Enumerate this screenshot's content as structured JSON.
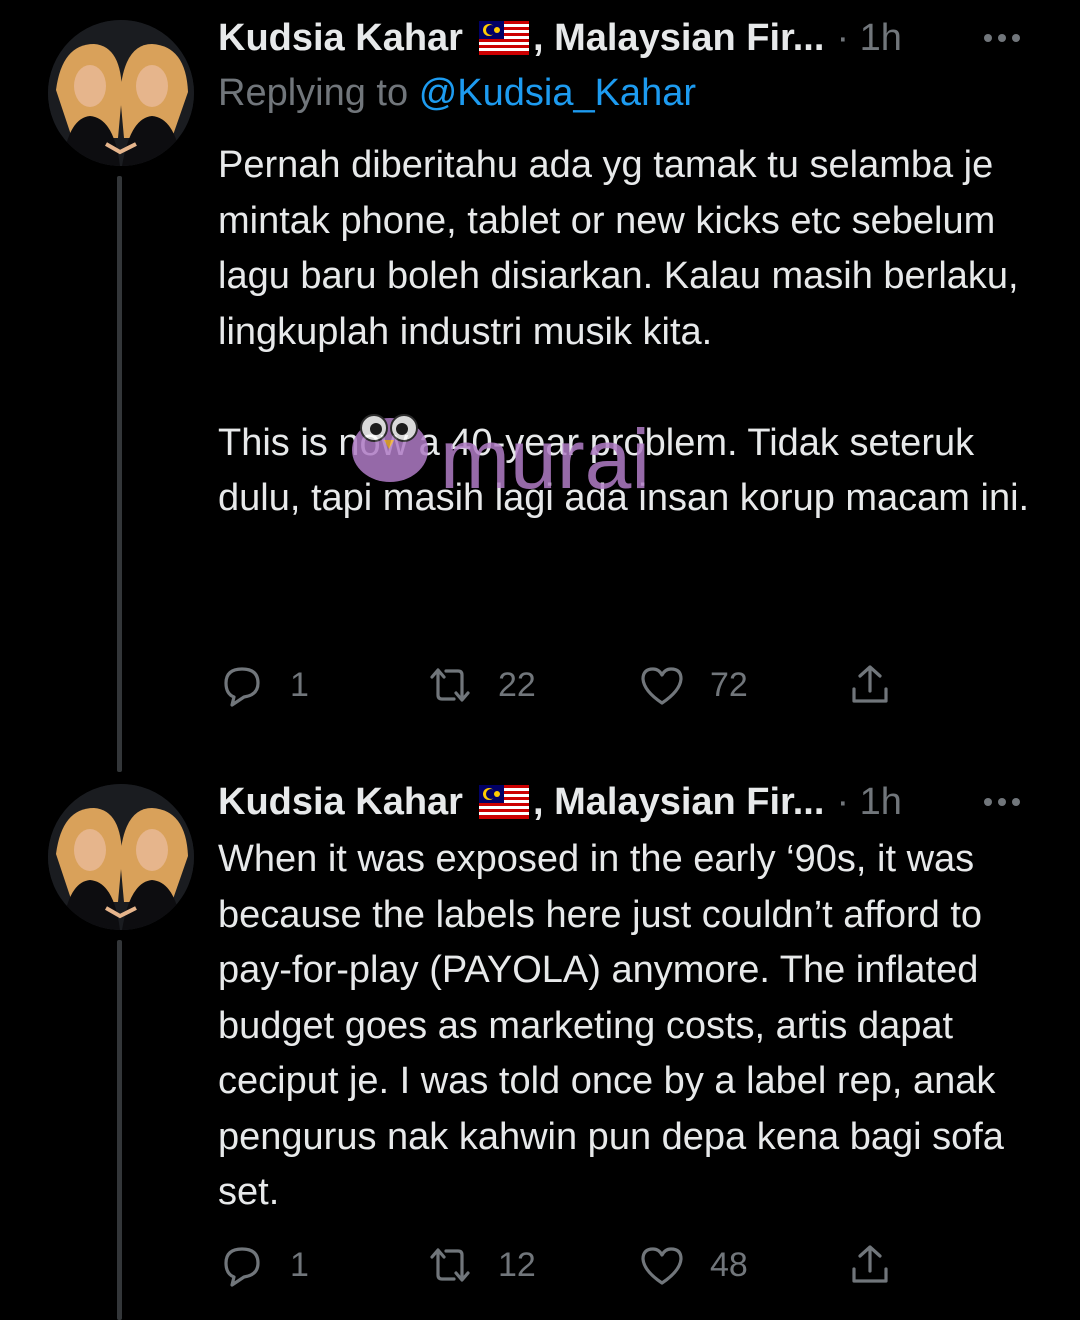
{
  "tweets": [
    {
      "author_name": "Kudsia Kahar",
      "flag_icon": "malaysia-flag-icon",
      "author_org": ", Malaysian Fir...",
      "time": "· 1h",
      "replying_prefix": "Replying to",
      "replying_handle": "@Kudsia_Kahar",
      "paragraphs": [
        "Pernah diberitahu ada yg tamak tu selamba je mintak phone, tablet or new kicks etc sebelum lagu baru boleh disiarkan. Kalau masih berlaku, lingkuplah industri musik kita.",
        "This is now a 40-year problem. Tidak seteruk dulu, tapi masih lagi ada insan korup macam ini."
      ],
      "replies": "1",
      "retweets": "22",
      "likes": "72"
    },
    {
      "author_name": "Kudsia Kahar",
      "flag_icon": "malaysia-flag-icon",
      "author_org": ", Malaysian Fir...",
      "time": "· 1h",
      "paragraphs": [
        "When it was exposed in the early ‘90s, it was because the labels here just couldn’t afford to pay-for-play (PAYOLA) anymore. The inflated budget goes as marketing costs, artis dapat ceciput je. I was told once by a label rep, anak pengurus nak kahwin pun depa kena bagi sofa set."
      ],
      "replies": "1",
      "retweets": "12",
      "likes": "48"
    }
  ],
  "watermark": {
    "text": "murai",
    "icon": "owl-icon"
  },
  "colors": {
    "background": "#000000",
    "text": "#e7e9ea",
    "secondary": "#71767b",
    "link": "#1d9bf0",
    "watermark": "#b07cc6"
  }
}
